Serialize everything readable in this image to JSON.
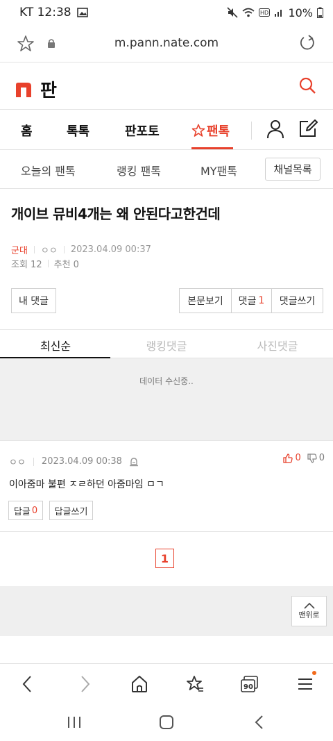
{
  "status": {
    "carrier_time": "KT 12:38",
    "battery": "10%"
  },
  "browser": {
    "url": "m.pann.nate.com"
  },
  "site": {
    "title": "판"
  },
  "nav": {
    "home": "홈",
    "toktok": "톡톡",
    "panpoto": "판포토",
    "pantok": "팬톡"
  },
  "subnav": {
    "today": "오늘의 팬톡",
    "ranking": "랭킹 팬톡",
    "my": "MY팬톡",
    "channels": "채널목록"
  },
  "post": {
    "title": "개이브 뮤비4개는 왜 안된다고한건데",
    "category": "군대",
    "author": "ㅇㅇ",
    "date": "2023.04.09 00:37",
    "views_label": "조회 12",
    "recommend_label": "추천 0"
  },
  "actions": {
    "my_comments": "내 댓글",
    "view_body": "본문보기",
    "comments_label": "댓글",
    "comments_count": "1",
    "write_comment": "댓글쓰기"
  },
  "comment_tabs": {
    "latest": "최신순",
    "ranking": "랭킹댓글",
    "photo": "사진댓글"
  },
  "loading_text": "데이터 수신중..",
  "comment": {
    "author": "ㅇㅇ",
    "date": "2023.04.09 00:38",
    "up": "0",
    "down": "0",
    "body": "이아줌마 불편 ㅈㄹ하던 아줌마임 ㅁㄱ",
    "reply_label": "답글",
    "reply_count": "0",
    "write_reply": "답글쓰기"
  },
  "pagination": {
    "current": "1"
  },
  "to_top": "맨위로",
  "toolbar": {
    "tabs_count": "90"
  },
  "colors": {
    "accent": "#e8412c",
    "notification_dot": "#f26a1b"
  }
}
